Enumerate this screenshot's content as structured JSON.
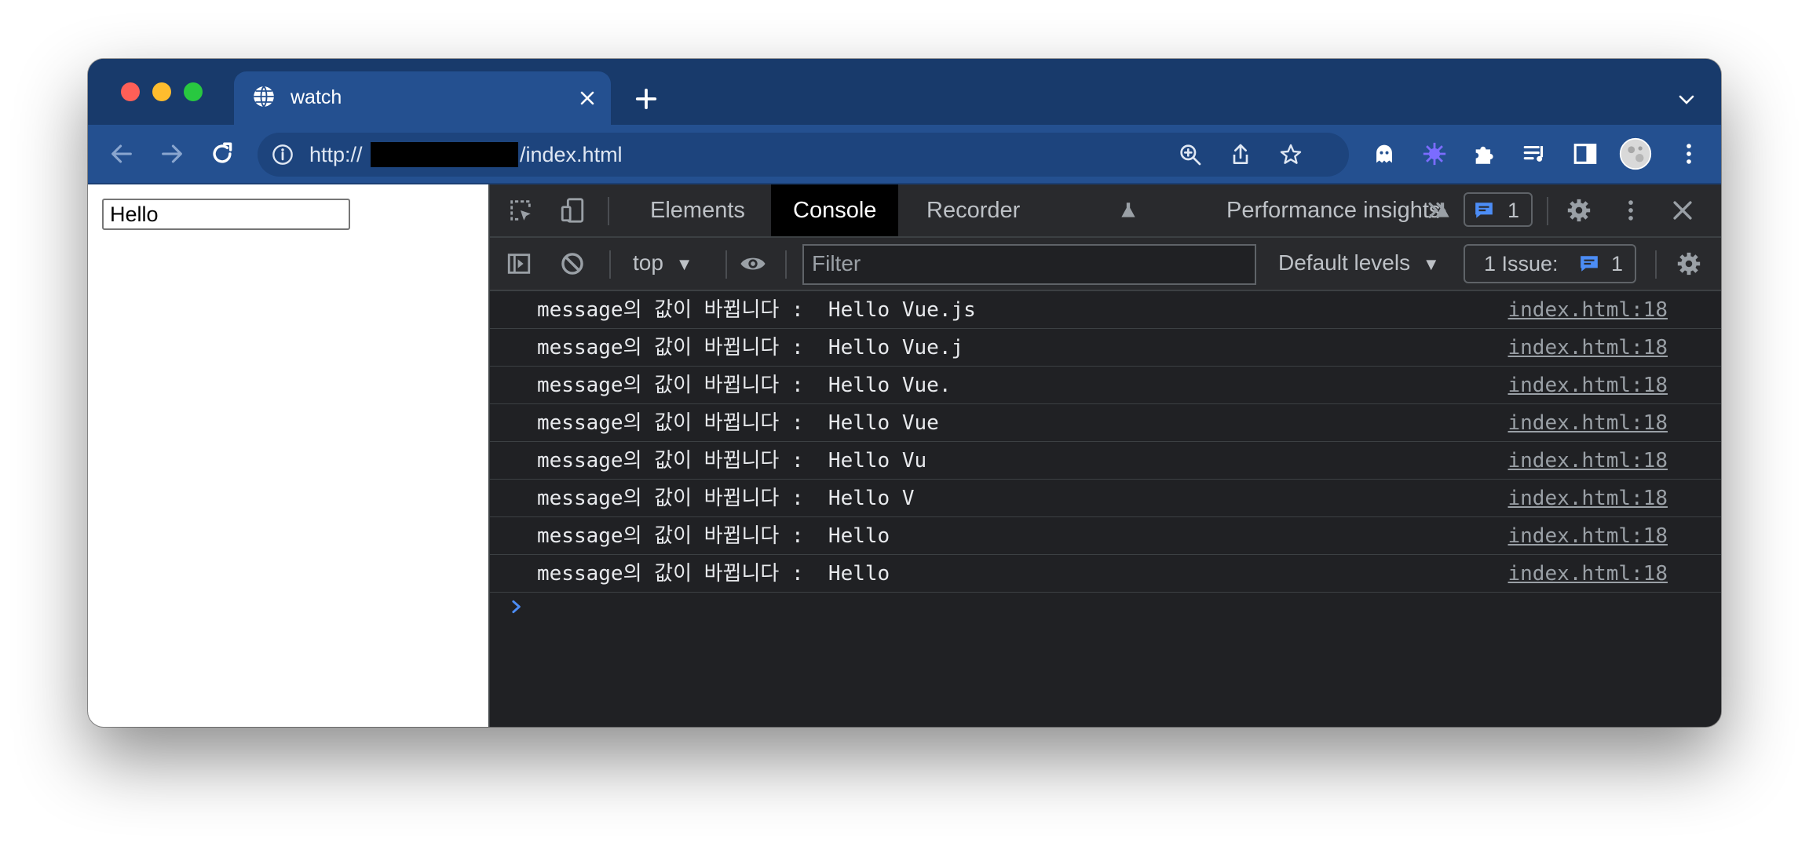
{
  "browser": {
    "tab_title": "watch",
    "url_prefix": "http://",
    "url_suffix": "/index.html"
  },
  "page": {
    "input_value": "Hello"
  },
  "devtools": {
    "tabs": [
      "Elements",
      "Console",
      "Recorder",
      "Performance insights"
    ],
    "active_tab": "Console",
    "message_badge_count": "1",
    "context": "top",
    "filter_placeholder": "Filter",
    "levels": "Default levels",
    "issues_label": "1 Issue:",
    "issues_count": "1",
    "logs": [
      {
        "message": "message의 값이 바뀝니다 :  Hello Vue.js",
        "source": "index.html:18"
      },
      {
        "message": "message의 값이 바뀝니다 :  Hello Vue.j",
        "source": "index.html:18"
      },
      {
        "message": "message의 값이 바뀝니다 :  Hello Vue.",
        "source": "index.html:18"
      },
      {
        "message": "message의 값이 바뀝니다 :  Hello Vue",
        "source": "index.html:18"
      },
      {
        "message": "message의 값이 바뀝니다 :  Hello Vu",
        "source": "index.html:18"
      },
      {
        "message": "message의 값이 바뀝니다 :  Hello V",
        "source": "index.html:18"
      },
      {
        "message": "message의 값이 바뀝니다 :  Hello",
        "source": "index.html:18"
      },
      {
        "message": "message의 값이 바뀝니다 :  Hello",
        "source": "index.html:18"
      }
    ]
  },
  "colors": {
    "tabstrip": "#183a6b",
    "toolbar": "#245090",
    "devtools_bg": "#202124",
    "accent_blue": "#4c8df6"
  }
}
